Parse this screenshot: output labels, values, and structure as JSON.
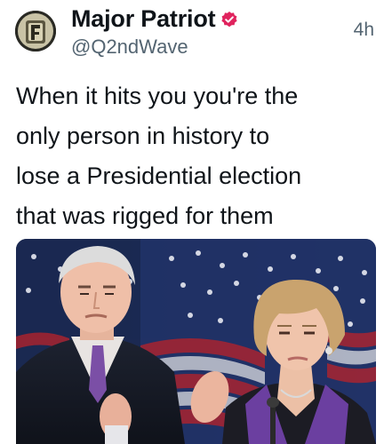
{
  "post": {
    "author": {
      "display_name": "Major Patriot",
      "handle": "@Q2ndWave",
      "verified_icon": "verified-badge-icon",
      "badge_color": "#e0245e"
    },
    "timestamp": "4h",
    "text": "When it hits you you're the\nonly person in history to\nlose a Presidential election\nthat was rigged for them",
    "media": {
      "kind": "photo",
      "icon": "photo-image"
    }
  }
}
